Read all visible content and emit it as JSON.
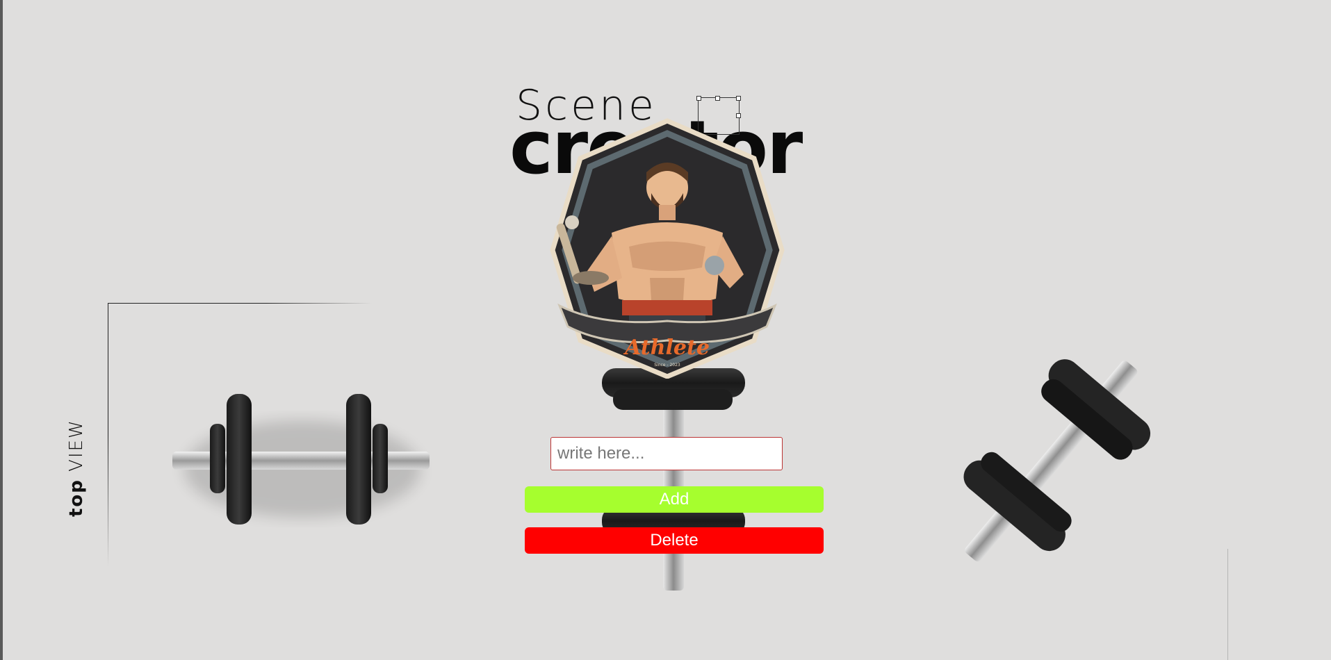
{
  "title": {
    "line1": "Scene",
    "line2": "creator"
  },
  "side_label": {
    "bold": "top",
    "light": "VIEW"
  },
  "logo": {
    "text": "Athlete",
    "sub": "Since - 2023"
  },
  "input": {
    "placeholder": "write here...",
    "value": ""
  },
  "buttons": {
    "add_label": "Add",
    "delete_label": "Delete"
  },
  "colors": {
    "background": "#dfdedd",
    "add_button": "#a6fe2e",
    "delete_button": "#ff0000",
    "logo_accent": "#e86a2b"
  }
}
